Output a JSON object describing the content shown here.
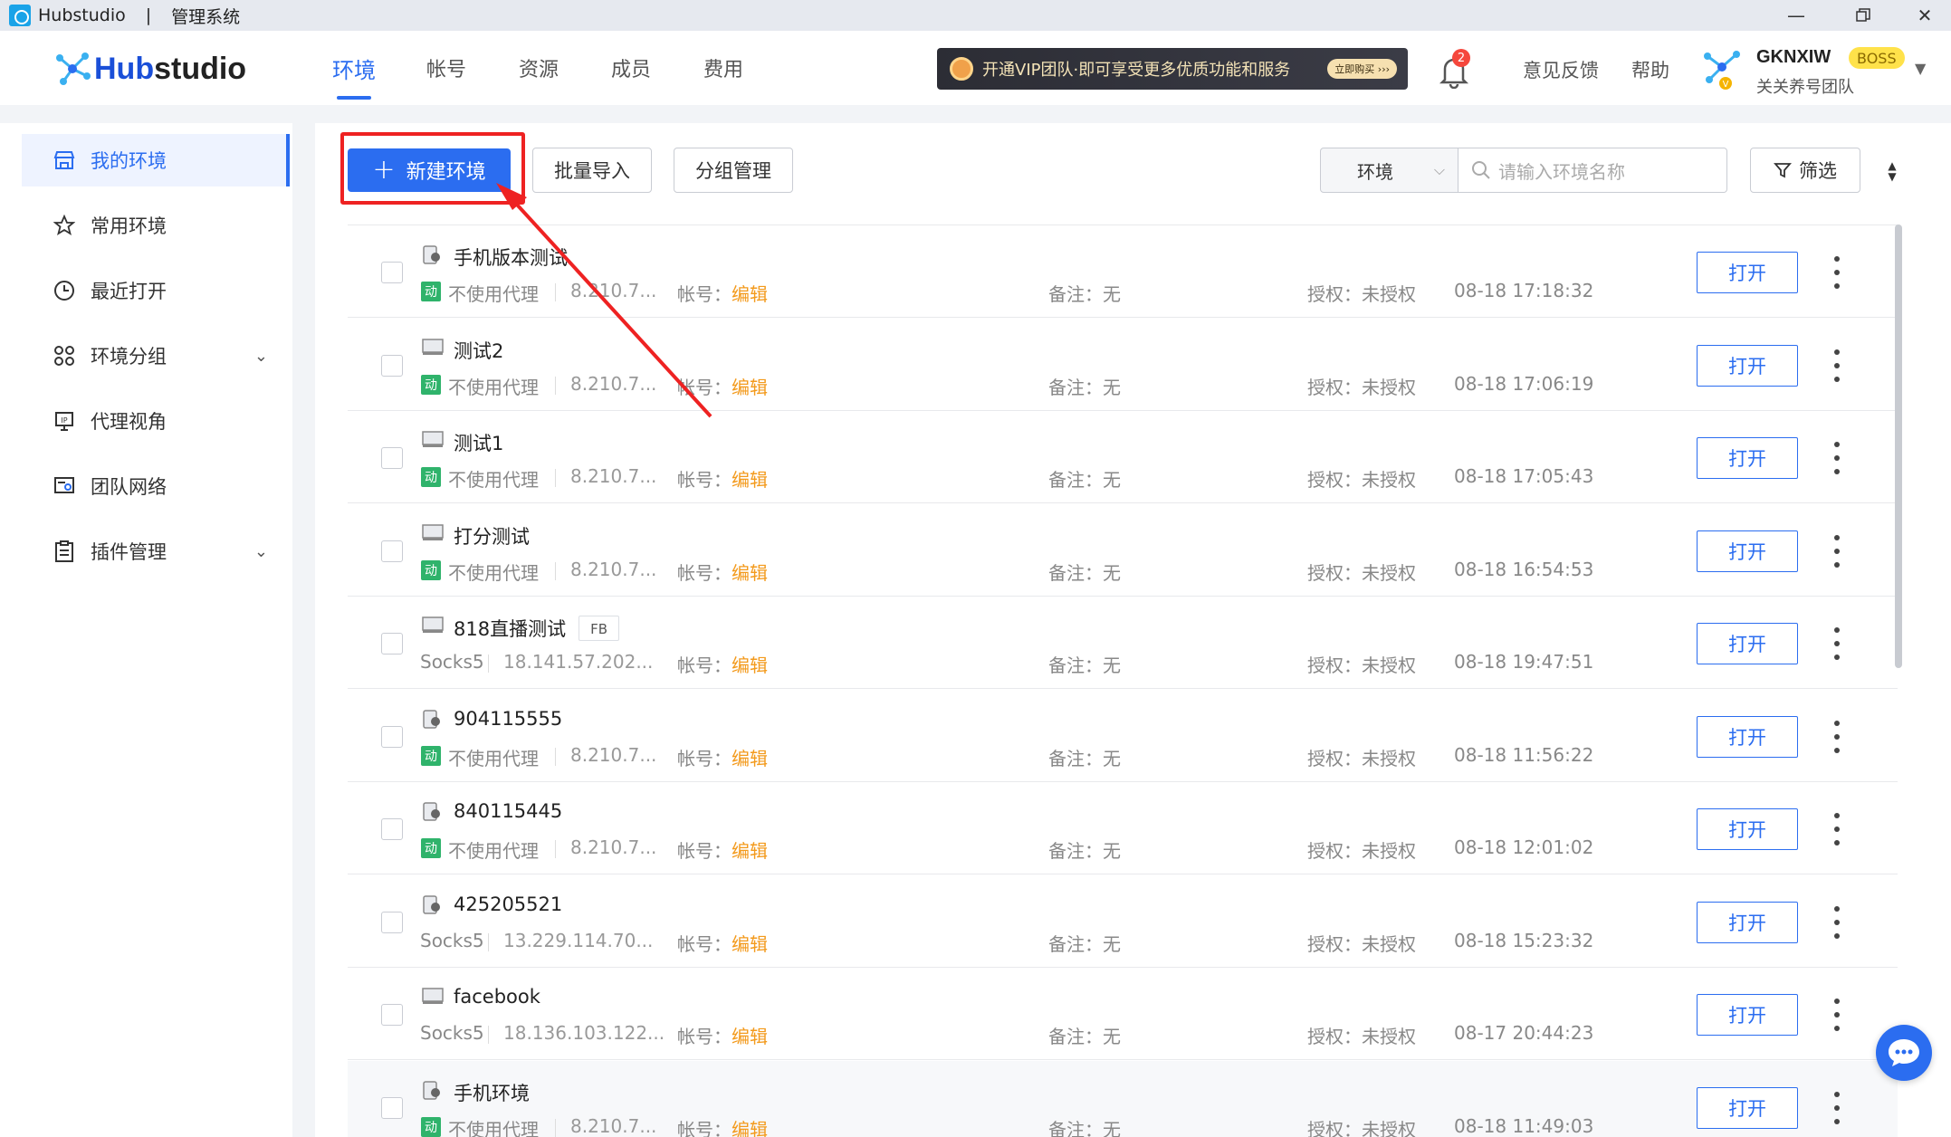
{
  "window": {
    "app_name": "Hubstudio",
    "separator": "|",
    "subtitle": "管理系统"
  },
  "header": {
    "logo_hub": "Hub",
    "logo_studio": "studio",
    "nav": [
      "环境",
      "帐号",
      "资源",
      "成员",
      "费用"
    ],
    "vip_banner": "开通VIP团队·即可享受更多优质功能和服务",
    "vip_buy": "立即购买 ›››",
    "notification_count": "2",
    "feedback": "意见反馈",
    "help": "帮助",
    "username": "GKNXIW",
    "role_badge": "BOSS",
    "team_name": "关关养号团队"
  },
  "sidebar": {
    "items": [
      {
        "label": "我的环境",
        "icon": "store-icon"
      },
      {
        "label": "常用环境",
        "icon": "star-icon"
      },
      {
        "label": "最近打开",
        "icon": "clock-icon"
      },
      {
        "label": "环境分组",
        "icon": "group-icon"
      },
      {
        "label": "代理视角",
        "icon": "ip-icon"
      },
      {
        "label": "团队网络",
        "icon": "team-network-icon"
      },
      {
        "label": "插件管理",
        "icon": "clipboard-icon"
      }
    ]
  },
  "toolbar": {
    "new_env": "新建环境",
    "batch_import": "批量导入",
    "group_manage": "分组管理",
    "env_select": "环境",
    "search_placeholder": "请输入环境名称",
    "filter": "筛选"
  },
  "labels": {
    "account": "帐号：",
    "edit": "编辑",
    "note": "备注：无",
    "auth": "授权：未授权",
    "open": "打开",
    "dynamic": "动"
  },
  "rows": [
    {
      "name": "手机版本测试",
      "device": "mobile",
      "proxy": "不使用代理",
      "ip": "8.210.7...",
      "dynamic": true,
      "time": "08-18 17:18:32",
      "tag": ""
    },
    {
      "name": "测试2",
      "device": "desktop",
      "proxy": "不使用代理",
      "ip": "8.210.7...",
      "dynamic": true,
      "time": "08-18 17:06:19",
      "tag": ""
    },
    {
      "name": "测试1",
      "device": "desktop",
      "proxy": "不使用代理",
      "ip": "8.210.7...",
      "dynamic": true,
      "time": "08-18 17:05:43",
      "tag": ""
    },
    {
      "name": "打分测试",
      "device": "desktop",
      "proxy": "不使用代理",
      "ip": "8.210.7...",
      "dynamic": true,
      "time": "08-18 16:54:53",
      "tag": ""
    },
    {
      "name": "818直播测试",
      "device": "desktop",
      "proxy": "Socks5",
      "ip": "18.141.57.202...",
      "dynamic": false,
      "time": "08-18 19:47:51",
      "tag": "FB"
    },
    {
      "name": "904115555",
      "device": "mobile",
      "proxy": "不使用代理",
      "ip": "8.210.7...",
      "dynamic": true,
      "time": "08-18 11:56:22",
      "tag": ""
    },
    {
      "name": "840115445",
      "device": "mobile",
      "proxy": "不使用代理",
      "ip": "8.210.7...",
      "dynamic": true,
      "time": "08-18 12:01:02",
      "tag": ""
    },
    {
      "name": "425205521",
      "device": "mobile",
      "proxy": "Socks5",
      "ip": "13.229.114.70...",
      "dynamic": false,
      "time": "08-18 15:23:32",
      "tag": ""
    },
    {
      "name": "facebook",
      "device": "desktop",
      "proxy": "Socks5",
      "ip": "18.136.103.122...",
      "dynamic": false,
      "time": "08-17 20:44:23",
      "tag": ""
    },
    {
      "name": "手机环境",
      "device": "mobile",
      "proxy": "不使用代理",
      "ip": "8.210.7...",
      "dynamic": true,
      "time": "08-18 11:49:03",
      "tag": ""
    }
  ],
  "colors": {
    "primary": "#2b6df0",
    "edit": "#f39a1c",
    "dynamic_badge": "#2fb36b",
    "annotation": "#ee2222"
  }
}
